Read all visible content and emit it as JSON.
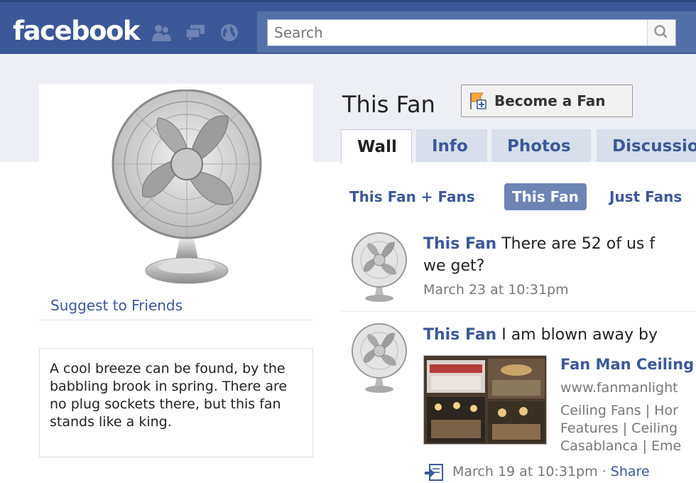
{
  "header": {
    "logo": "facebook",
    "search_placeholder": "Search",
    "colors": {
      "bar": "#3b5998",
      "link": "#3b5998",
      "band": "#edeff4"
    },
    "icons": [
      "friends-icon",
      "messages-icon",
      "notifications-globe-icon",
      "search-magnifier-icon"
    ]
  },
  "sidebar": {
    "suggest_link": "Suggest to Friends",
    "bio": "A cool breeze can be found, by the babbling brook in spring. There are no plug sockets there, but this fan stands like a king."
  },
  "page": {
    "title": "This Fan",
    "become_fan_label": "Become a Fan",
    "tabs": [
      {
        "label": "Wall",
        "active": true
      },
      {
        "label": "Info",
        "active": false
      },
      {
        "label": "Photos",
        "active": false
      },
      {
        "label": "Discussio",
        "active": false
      }
    ],
    "filters": [
      {
        "label": "This Fan + Fans",
        "active": false
      },
      {
        "label": "This Fan",
        "active": true
      },
      {
        "label": "Just Fans",
        "active": false
      }
    ]
  },
  "posts": [
    {
      "author": "This Fan",
      "text_line1": "There are 52 of us f",
      "text_line2": "we get?",
      "time": "March 23 at 10:31pm"
    },
    {
      "author": "This Fan",
      "text_line1": "I am blown away by",
      "attachment": {
        "title": "Fan Man Ceiling",
        "url": "www.fanmanlight",
        "desc_line1": "Ceiling Fans | Hor",
        "desc_line2": "Features | Ceiling",
        "desc_line3": "Casablanca | Eme"
      },
      "time": "March 19 at 10:31pm",
      "separator": "·",
      "share": "Share"
    }
  ]
}
